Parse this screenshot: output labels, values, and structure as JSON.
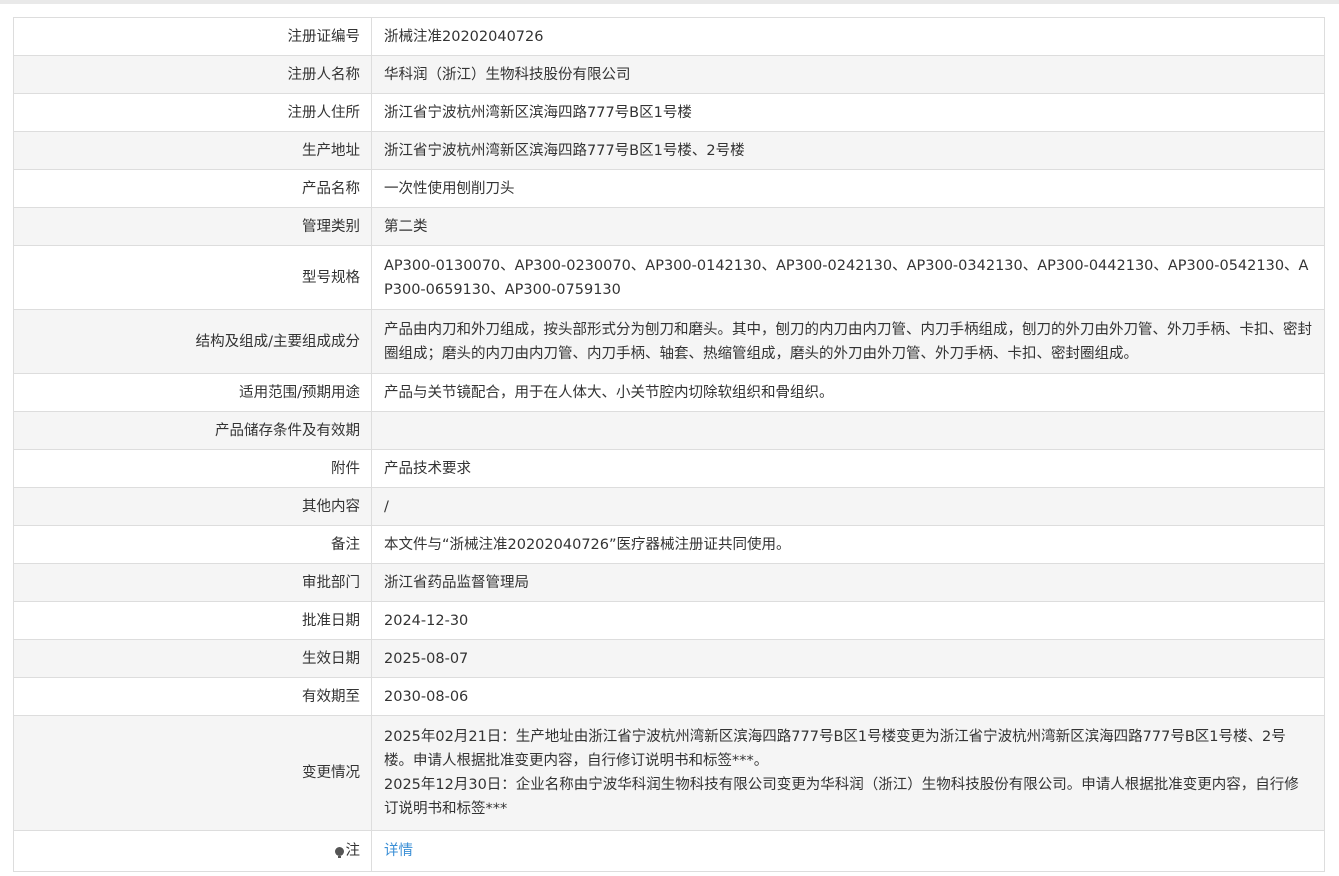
{
  "rows": [
    {
      "label": "注册证编号",
      "value": "浙械注准20202040726"
    },
    {
      "label": "注册人名称",
      "value": "华科润（浙江）生物科技股份有限公司"
    },
    {
      "label": "注册人住所",
      "value": "浙江省宁波杭州湾新区滨海四路777号B区1号楼"
    },
    {
      "label": "生产地址",
      "value": "浙江省宁波杭州湾新区滨海四路777号B区1号楼、2号楼"
    },
    {
      "label": "产品名称",
      "value": "一次性使用刨削刀头"
    },
    {
      "label": "管理类别",
      "value": "第二类"
    },
    {
      "label": "型号规格",
      "value": "AP300-0130070、AP300-0230070、AP300-0142130、AP300-0242130、AP300-0342130、AP300-0442130、AP300-0542130、AP300-0659130、AP300-0759130"
    },
    {
      "label": "结构及组成/主要组成成分",
      "value": "产品由内刀和外刀组成，按头部形式分为刨刀和磨头。其中，刨刀的内刀由内刀管、内刀手柄组成，刨刀的外刀由外刀管、外刀手柄、卡扣、密封圈组成；磨头的内刀由内刀管、内刀手柄、轴套、热缩管组成，磨头的外刀由外刀管、外刀手柄、卡扣、密封圈组成。"
    },
    {
      "label": "适用范围/预期用途",
      "value": "产品与关节镜配合，用于在人体大、小关节腔内切除软组织和骨组织。"
    },
    {
      "label": "产品储存条件及有效期",
      "value": ""
    },
    {
      "label": "附件",
      "value": "产品技术要求"
    },
    {
      "label": "其他内容",
      "value": "/"
    },
    {
      "label": "备注",
      "value": "本文件与“浙械注准20202040726”医疗器械注册证共同使用。"
    },
    {
      "label": "审批部门",
      "value": "浙江省药品监督管理局"
    },
    {
      "label": "批准日期",
      "value": "2024-12-30"
    },
    {
      "label": "生效日期",
      "value": "2025-08-07"
    },
    {
      "label": "有效期至",
      "value": "2030-08-06"
    }
  ],
  "changes": {
    "label": "变更情况",
    "entries": [
      "2025年02月21日：生产地址由浙江省宁波杭州湾新区滨海四路777号B区1号楼变更为浙江省宁波杭州湾新区滨海四路777号B区1号楼、2号楼。申请人根据批准变更内容，自行修订说明书和标签***。",
      "2025年12月30日：企业名称由宁波华科润生物科技有限公司变更为华科润（浙江）生物科技股份有限公司。申请人根据批准变更内容，自行修订说明书和标签***"
    ]
  },
  "note": {
    "icon": "bulb-icon",
    "label": "注",
    "link_text": "详情"
  }
}
